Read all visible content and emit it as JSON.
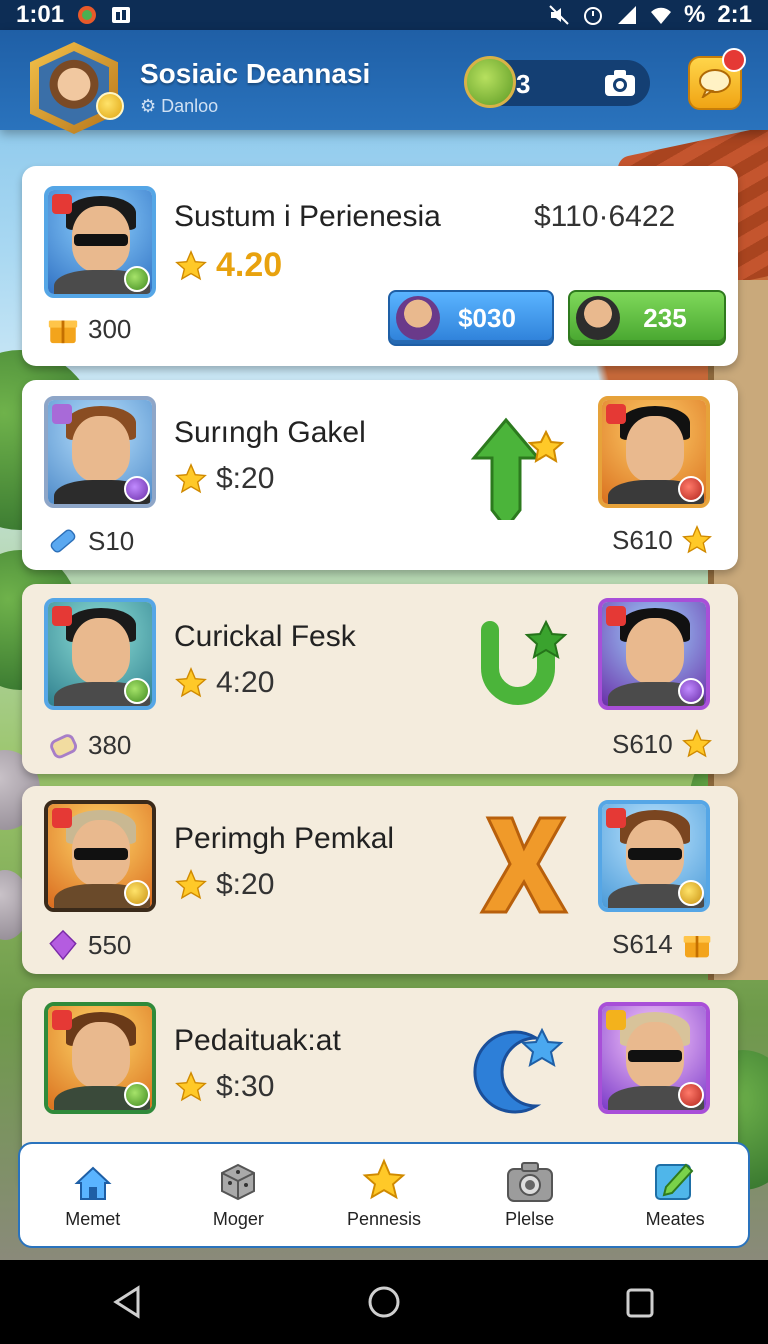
{
  "status_bar": {
    "time": "1:01",
    "battery_text": "%",
    "clock_right": "2:1"
  },
  "header": {
    "player_name": "Sosiaic Deannasi",
    "player_sub": "Danloo",
    "coin_count": "3"
  },
  "cards": [
    {
      "title": "Sustum i Perienesia",
      "rating": "4.20",
      "top_price": "$110·6422",
      "cost": "300",
      "blue_button": "$030",
      "green_button": "235"
    },
    {
      "title": "Surıngh Gakel",
      "rating": "$:20",
      "cost": "S10",
      "right_price": "S610"
    },
    {
      "title": "Curickal Fesk",
      "rating": "4:20",
      "cost": "380",
      "right_price": "S610"
    },
    {
      "title": "Perimgh Pemkal",
      "rating": "$:20",
      "cost": "550",
      "right_price": "S614"
    },
    {
      "title": "Pedaituak:at",
      "rating": "$:30",
      "cost": "",
      "right_price": ""
    }
  ],
  "bottom_nav": [
    {
      "label": "Memet",
      "icon": "home-icon"
    },
    {
      "label": "Moger",
      "icon": "dice-icon"
    },
    {
      "label": "Pennesis",
      "icon": "star-icon"
    },
    {
      "label": "Plelse",
      "icon": "camera-icon"
    },
    {
      "label": "Meates",
      "icon": "edit-icon"
    }
  ],
  "colors": {
    "header_blue": "#2a73bd",
    "button_blue": "#2d7fd8",
    "button_green": "#46a52e",
    "gold": "#e8a20e"
  }
}
